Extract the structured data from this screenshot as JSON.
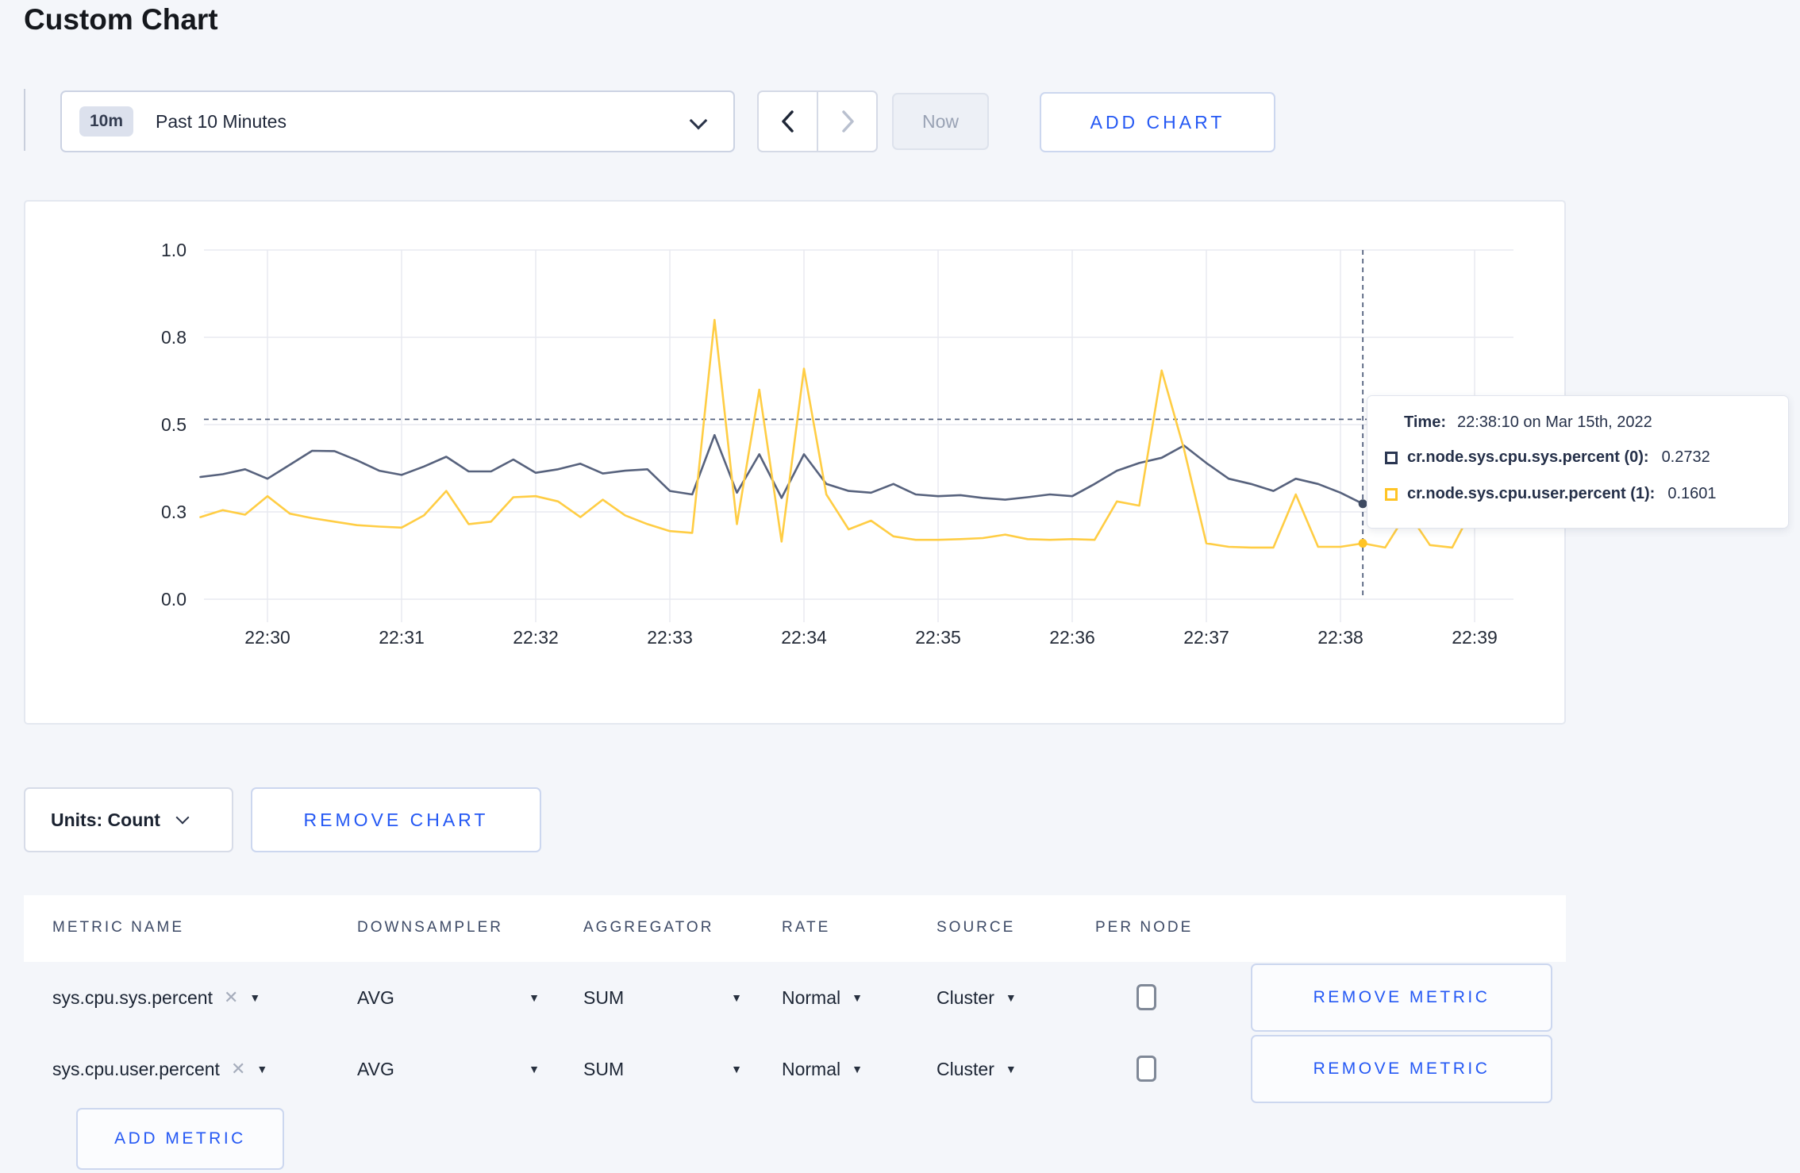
{
  "page": {
    "title": "Custom Chart"
  },
  "toolbar": {
    "time_badge": "10m",
    "time_label": "Past 10 Minutes",
    "prev_arrow": "chevron-left",
    "next_arrow": "chevron-right",
    "now_label": "Now",
    "add_chart_label": "ADD CHART"
  },
  "tooltip": {
    "time_label": "Time:",
    "time_value": "22:38:10 on Mar 15th, 2022",
    "series": [
      {
        "label": "cr.node.sys.cpu.sys.percent (0):",
        "value": "0.2732",
        "swatch_color": "#2a3652"
      },
      {
        "label": "cr.node.sys.cpu.user.percent (1):",
        "value": "0.1601",
        "swatch_color": "#ffc425"
      }
    ]
  },
  "chart_controls": {
    "units_label": "Units: Count",
    "remove_chart_label": "REMOVE CHART"
  },
  "metrics_table": {
    "headers": [
      "METRIC NAME",
      "DOWNSAMPLER",
      "AGGREGATOR",
      "RATE",
      "SOURCE",
      "PER NODE"
    ],
    "rows": [
      {
        "name": "sys.cpu.sys.percent",
        "clear": "✕",
        "downsampler": "AVG",
        "aggregator": "SUM",
        "rate": "Normal",
        "source": "Cluster",
        "per_node_checked": false,
        "remove_label": "REMOVE METRIC"
      },
      {
        "name": "sys.cpu.user.percent",
        "clear": "✕",
        "downsampler": "AVG",
        "aggregator": "SUM",
        "rate": "Normal",
        "source": "Cluster",
        "per_node_checked": false,
        "remove_label": "REMOVE METRIC"
      }
    ],
    "add_metric_label": "ADD METRIC"
  },
  "chart_data": {
    "type": "line",
    "title": "",
    "xlabel": "",
    "ylabel": "",
    "grid": true,
    "ylim": [
      0,
      1
    ],
    "y_tick_values": [
      0,
      0.25,
      0.5,
      0.75,
      1.0
    ],
    "y_tick_labels": [
      "0.0",
      "0.3",
      "0.5",
      "0.8",
      "1.0"
    ],
    "x_ticks": [
      "22:30",
      "22:31",
      "22:32",
      "22:33",
      "22:34",
      "22:35",
      "22:36",
      "22:37",
      "22:38",
      "22:39"
    ],
    "x_start": "22:29:30",
    "x_end": "22:39:10",
    "x_step_seconds": 10,
    "crosshair": {
      "time": "22:38:10",
      "point_index": 52,
      "y_value": 0.515,
      "color": "#55627f"
    },
    "series": [
      {
        "name": "cr.node.sys.cpu.sys.percent (0)",
        "color": "#57627d",
        "values": [
          0.35,
          0.358,
          0.372,
          0.345,
          0.385,
          0.425,
          0.424,
          0.398,
          0.368,
          0.356,
          0.38,
          0.408,
          0.366,
          0.366,
          0.4,
          0.362,
          0.372,
          0.388,
          0.36,
          0.368,
          0.372,
          0.31,
          0.3,
          0.47,
          0.305,
          0.415,
          0.29,
          0.415,
          0.33,
          0.31,
          0.305,
          0.33,
          0.3,
          0.295,
          0.298,
          0.29,
          0.285,
          0.292,
          0.3,
          0.295,
          0.33,
          0.368,
          0.39,
          0.405,
          0.44,
          0.39,
          0.345,
          0.33,
          0.31,
          0.345,
          0.33,
          0.305,
          0.2732,
          0.3,
          0.285,
          0.295,
          0.305,
          0.318,
          0.302
        ]
      },
      {
        "name": "cr.node.sys.cpu.user.percent (1)",
        "color": "#ffcd44",
        "values": [
          0.235,
          0.255,
          0.242,
          0.295,
          0.245,
          0.232,
          0.222,
          0.212,
          0.208,
          0.205,
          0.24,
          0.31,
          0.215,
          0.222,
          0.292,
          0.295,
          0.28,
          0.235,
          0.285,
          0.24,
          0.215,
          0.195,
          0.19,
          0.8,
          0.215,
          0.6,
          0.165,
          0.66,
          0.3,
          0.2,
          0.225,
          0.18,
          0.17,
          0.17,
          0.172,
          0.175,
          0.185,
          0.172,
          0.17,
          0.172,
          0.17,
          0.28,
          0.268,
          0.655,
          0.43,
          0.16,
          0.15,
          0.148,
          0.148,
          0.3,
          0.15,
          0.15,
          0.1601,
          0.148,
          0.25,
          0.155,
          0.148,
          0.27,
          0.235
        ]
      }
    ],
    "highlighted_points": [
      {
        "series": 0,
        "time": "22:38:10",
        "value": 0.2732,
        "color": "#3f4b63"
      },
      {
        "series": 1,
        "time": "22:38:10",
        "value": 0.1601,
        "color": "#ffc425"
      }
    ],
    "legend_position": "tooltip-only"
  }
}
